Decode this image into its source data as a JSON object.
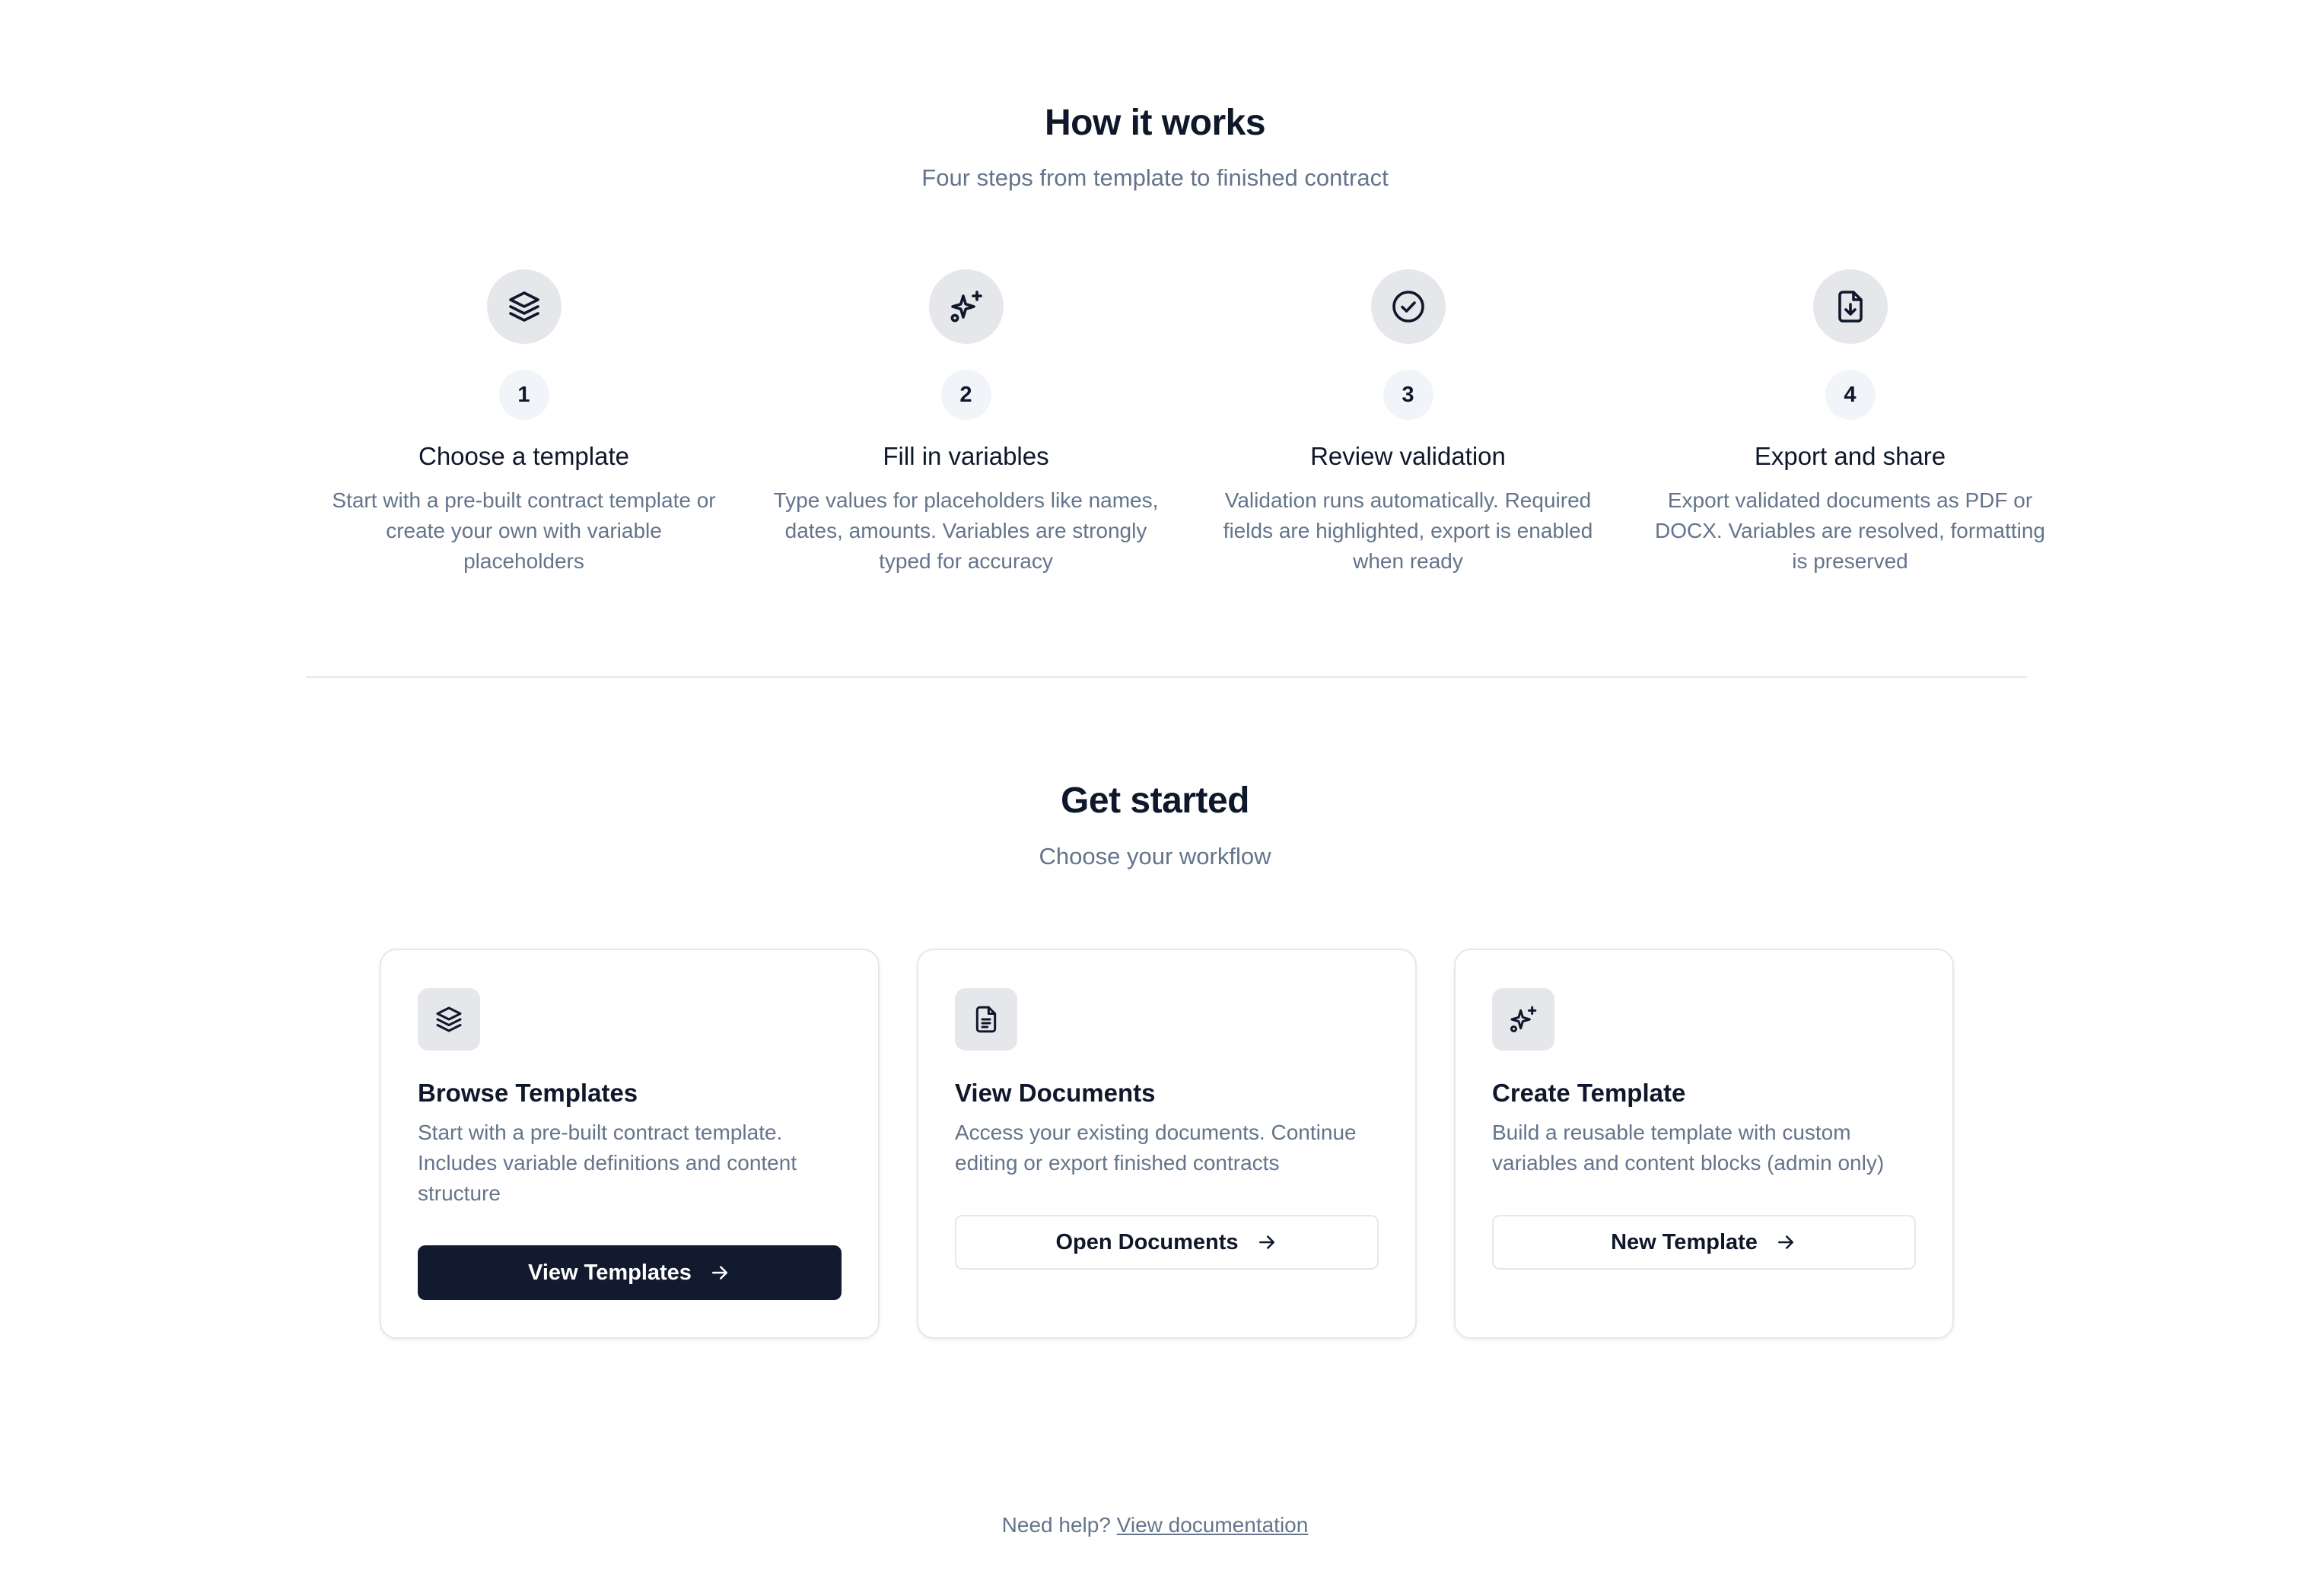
{
  "how_it_works": {
    "title": "How it works",
    "subtitle": "Four steps from template to finished contract",
    "steps": [
      {
        "icon": "layers-icon",
        "number": "1",
        "title": "Choose a template",
        "description": "Start with a pre-built contract template or create your own with variable placeholders"
      },
      {
        "icon": "sparkles-icon",
        "number": "2",
        "title": "Fill in variables",
        "description": "Type values for placeholders like names, dates, amounts. Variables are strongly typed for accuracy"
      },
      {
        "icon": "check-circle-icon",
        "number": "3",
        "title": "Review validation",
        "description": "Validation runs automatically. Required fields are highlighted, export is enabled when ready"
      },
      {
        "icon": "file-download-icon",
        "number": "4",
        "title": "Export and share",
        "description": "Export validated documents as PDF or DOCX. Variables are resolved, formatting is preserved"
      }
    ]
  },
  "get_started": {
    "title": "Get started",
    "subtitle": "Choose your workflow",
    "cards": [
      {
        "icon": "layers-icon",
        "title": "Browse Templates",
        "description": "Start with a pre-built contract template. Includes variable definitions and content structure",
        "button_label": "View Templates",
        "button_style": "primary"
      },
      {
        "icon": "document-icon",
        "title": "View Documents",
        "description": "Access your existing documents. Continue editing or export finished contracts",
        "button_label": "Open Documents",
        "button_style": "outline"
      },
      {
        "icon": "sparkles-icon",
        "title": "Create Template",
        "description": "Build a reusable template with custom variables and content blocks (admin only)",
        "button_label": "New Template",
        "button_style": "outline"
      }
    ]
  },
  "footer": {
    "help_text": "Need help?",
    "link_text": "View documentation"
  },
  "colors": {
    "text_primary": "#0f172a",
    "text_muted": "#64748b",
    "icon_bg": "#e5e7eb",
    "primary_button": "#111a2e",
    "border": "#e5e7eb"
  }
}
